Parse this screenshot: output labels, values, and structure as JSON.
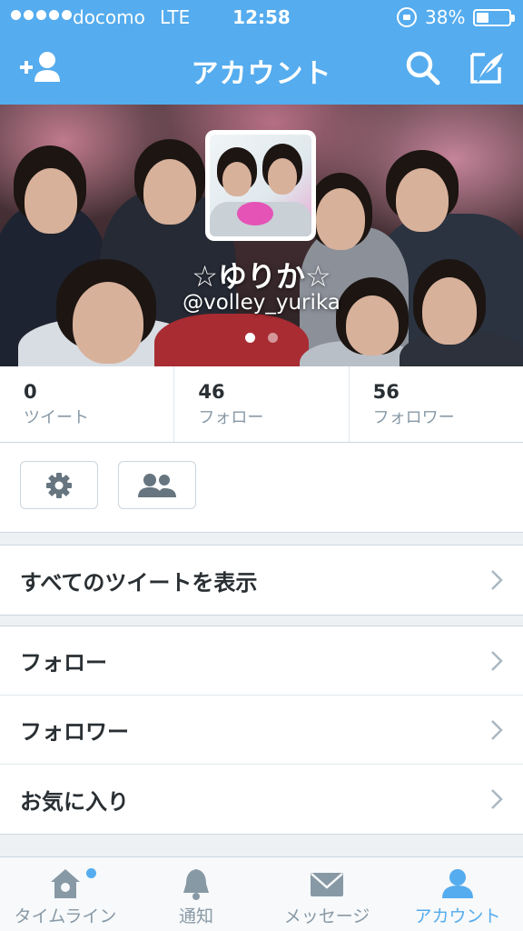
{
  "status_bar": {
    "carrier": "docomo",
    "network": "LTE",
    "time": "12:58",
    "battery_percent_label": "38%",
    "battery_level": 0.38,
    "signal_dots": 5
  },
  "nav": {
    "title": "アカウント",
    "left_icon": "add-user-icon",
    "right_icons": [
      "search-icon",
      "compose-icon"
    ]
  },
  "profile": {
    "name": "☆ゆりか☆",
    "handle": "@volley_yurika",
    "header_pages": 2,
    "active_page": 1
  },
  "stats": [
    {
      "count": "0",
      "label": "ツイート"
    },
    {
      "count": "46",
      "label": "フォロー"
    },
    {
      "count": "56",
      "label": "フォロワー"
    }
  ],
  "actions": [
    {
      "icon": "gear-icon"
    },
    {
      "icon": "people-icon"
    }
  ],
  "list_sections": [
    {
      "items": [
        "すべてのツイートを表示"
      ]
    },
    {
      "items": [
        "フォロー",
        "フォロワー",
        "お気に入り"
      ]
    }
  ],
  "tabs": [
    {
      "label": "タイムライン",
      "icon": "home-icon",
      "active": false,
      "has_badge": true
    },
    {
      "label": "通知",
      "icon": "bell-icon",
      "active": false,
      "has_badge": false
    },
    {
      "label": "メッセージ",
      "icon": "mail-icon",
      "active": false,
      "has_badge": false
    },
    {
      "label": "アカウント",
      "icon": "person-icon",
      "active": true,
      "has_badge": false
    }
  ],
  "colors": {
    "brand_blue": "#55acee",
    "text": "#292f33",
    "muted": "#8899a6"
  }
}
